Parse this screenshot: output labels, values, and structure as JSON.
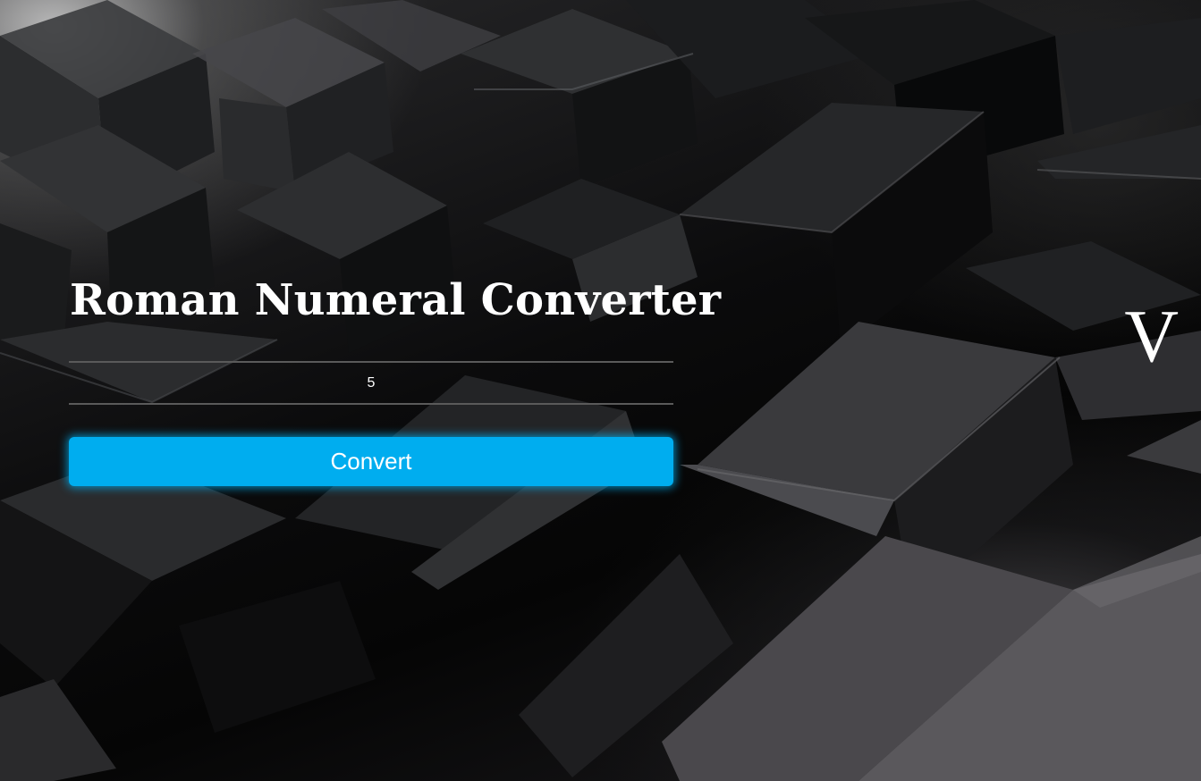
{
  "app": {
    "title": "Roman Numeral Converter"
  },
  "input": {
    "value": "5",
    "type": "number"
  },
  "convert_button": {
    "label": "Convert",
    "color": "#00adef"
  },
  "result": {
    "value": "V"
  },
  "theme": {
    "background": "#000000",
    "text_color": "#ffffff",
    "accent": "#00adef"
  }
}
